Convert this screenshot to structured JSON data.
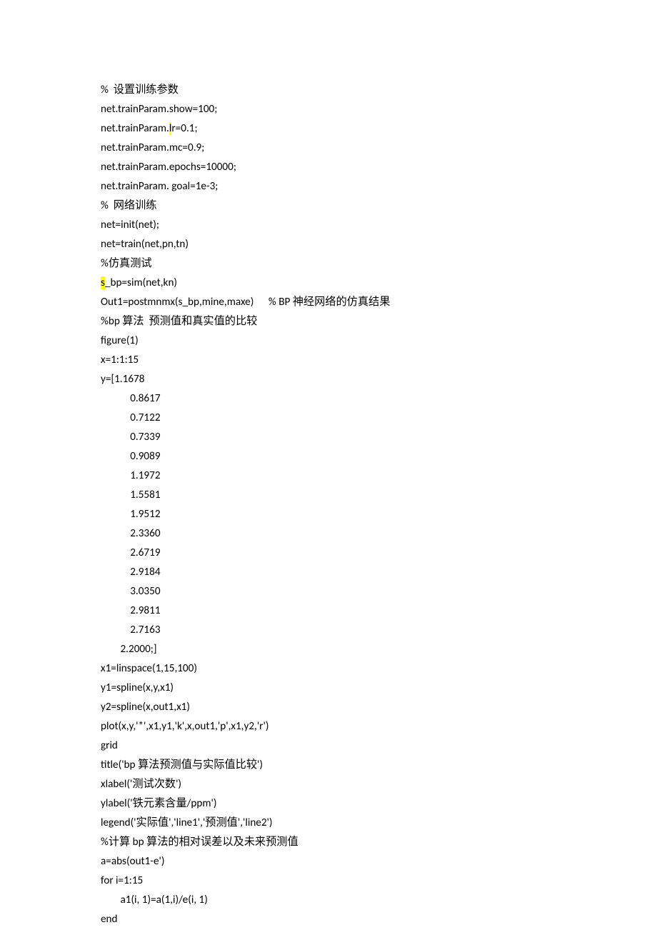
{
  "lines": [
    {
      "segs": [
        {
          "t": "%  设置训练参数"
        }
      ]
    },
    {
      "segs": [
        {
          "t": "net.trainParam.show=100;"
        }
      ]
    },
    {
      "segs": [
        {
          "t": "net.trainParam."
        },
        {
          "t": "l",
          "hl": true
        },
        {
          "t": "r=0.1;"
        }
      ]
    },
    {
      "segs": [
        {
          "t": "net.trainParam.mc=0.9;"
        }
      ]
    },
    {
      "segs": [
        {
          "t": "net.trainParam.epochs=10000;"
        }
      ]
    },
    {
      "segs": [
        {
          "t": "net.trainParam. goal=1e-3;"
        }
      ]
    },
    {
      "segs": [
        {
          "t": "%  网络训练"
        }
      ]
    },
    {
      "segs": [
        {
          "t": "net=init(net);"
        }
      ]
    },
    {
      "segs": [
        {
          "t": "net=train(net,pn,tn)"
        }
      ]
    },
    {
      "segs": [
        {
          "t": "%仿真测试"
        }
      ]
    },
    {
      "segs": [
        {
          "t": "s",
          "hl": true
        },
        {
          "t": "_bp=sim(net,kn)"
        }
      ]
    },
    {
      "segs": [
        {
          "t": "Out1=postmnmx(s_bp,mine,maxe)      % BP 神经网络的仿真结果"
        }
      ]
    },
    {
      "segs": [
        {
          "t": "%bp 算法  预测值和真实值的比较"
        }
      ]
    },
    {
      "segs": [
        {
          "t": "figure(1)"
        }
      ]
    },
    {
      "segs": [
        {
          "t": "x=1:1:15"
        }
      ]
    },
    {
      "segs": [
        {
          "t": "y=[1.1678"
        }
      ]
    },
    {
      "segs": [
        {
          "t": "            0.8617"
        }
      ]
    },
    {
      "segs": [
        {
          "t": "            0.7122"
        }
      ]
    },
    {
      "segs": [
        {
          "t": "            0.7339"
        }
      ]
    },
    {
      "segs": [
        {
          "t": "            0.9089"
        }
      ]
    },
    {
      "segs": [
        {
          "t": "            1.1972"
        }
      ]
    },
    {
      "segs": [
        {
          "t": "            1.5581"
        }
      ]
    },
    {
      "segs": [
        {
          "t": "            1.9512"
        }
      ]
    },
    {
      "segs": [
        {
          "t": "            2.3360"
        }
      ]
    },
    {
      "segs": [
        {
          "t": "            2.6719"
        }
      ]
    },
    {
      "segs": [
        {
          "t": "            2.9184"
        }
      ]
    },
    {
      "segs": [
        {
          "t": "            3.0350"
        }
      ]
    },
    {
      "segs": [
        {
          "t": "            2.9811"
        }
      ]
    },
    {
      "segs": [
        {
          "t": "            2.7163"
        }
      ]
    },
    {
      "segs": [
        {
          "t": "        2.2000;]"
        }
      ]
    },
    {
      "segs": [
        {
          "t": "x1=linspace(1,15,100)"
        }
      ]
    },
    {
      "segs": [
        {
          "t": "y1=spline(x,y,x1)"
        }
      ]
    },
    {
      "segs": [
        {
          "t": "y2=spline(x,out1,x1)"
        }
      ]
    },
    {
      "segs": [
        {
          "t": "plot(x,y,'*',x1,y1,'k',x,out1,'p',x1,y2,'r')"
        }
      ]
    },
    {
      "segs": [
        {
          "t": "grid"
        }
      ]
    },
    {
      "segs": [
        {
          "t": "title('bp 算法预测值与实际值比较')"
        }
      ]
    },
    {
      "segs": [
        {
          "t": "xlabel('测试次数')"
        }
      ]
    },
    {
      "segs": [
        {
          "t": "ylabel('铁元素含量/ppm')"
        }
      ]
    },
    {
      "segs": [
        {
          "t": "legend('实际值','line1','预测值','line2')"
        }
      ]
    },
    {
      "segs": [
        {
          "t": "%计算 bp 算法的相对误差以及未来预测值"
        }
      ]
    },
    {
      "segs": [
        {
          "t": "a=abs(out1-e')"
        }
      ]
    },
    {
      "segs": [
        {
          "t": "for i=1:15"
        }
      ]
    },
    {
      "segs": [
        {
          "t": "        a1(i, 1)=a(1,i)/e(i, 1)"
        }
      ]
    },
    {
      "segs": [
        {
          "t": "end"
        }
      ]
    }
  ]
}
